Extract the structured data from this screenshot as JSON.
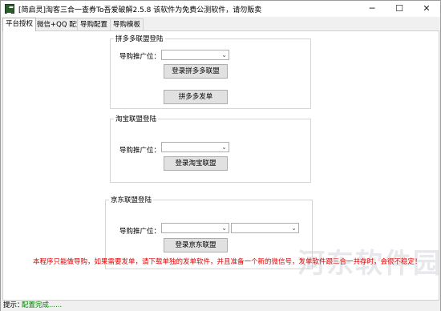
{
  "window": {
    "title": "[简启灵]淘客三合一查券To吾爱破解2.5.8  该软件为免费公测软件，请勿贩卖",
    "min_icon": "─",
    "max_icon": "☐",
    "close_icon": "✕"
  },
  "tabs": [
    "平台授权",
    "微信+QQ 配置",
    "导购配置",
    "导购模板"
  ],
  "pdd": {
    "title": "拼多多联盟登陆",
    "position_label": "导购推广位：",
    "login_button": "登录拼多多联盟",
    "send_button": "拼多多发单"
  },
  "taobao": {
    "title": "淘宝联盟登陆",
    "position_label": "导购推广位：",
    "login_button": "登录淘宝联盟"
  },
  "jd": {
    "title": "京东联盟登陆",
    "position_label": "导购推广位：",
    "login_button": "登录京东联盟"
  },
  "notice": "本程序只能做导购，如果需要发单，请下载单独的发单软件，并且准备一个新的微信号，发单软件跟三合一共存时，会很不稳定！",
  "watermark": "河东软件园",
  "status": {
    "label": "提示：",
    "value": "配置完成......"
  }
}
